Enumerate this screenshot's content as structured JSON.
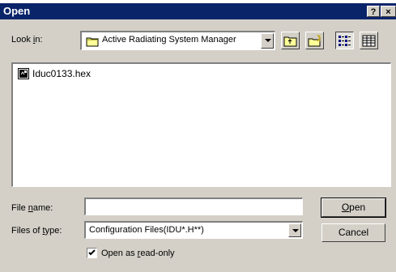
{
  "dialog": {
    "title": "Open"
  },
  "titlebar_buttons": {
    "help": "?",
    "close": "×"
  },
  "lookin": {
    "label_pre": "Look ",
    "label_u": "i",
    "label_post": "n:",
    "value": "Active Radiating System Manager"
  },
  "toolbar": {
    "icons": [
      "up-one-level-icon",
      "new-folder-icon",
      "list-view-icon",
      "details-view-icon"
    ]
  },
  "files": [
    {
      "name": "Iduc0133.hex",
      "icon": "hex-file-icon"
    }
  ],
  "filename": {
    "label_pre": "File ",
    "label_u": "n",
    "label_post": "ame:",
    "value": ""
  },
  "filetype": {
    "label_pre": "Files of ",
    "label_u": "t",
    "label_post": "ype:",
    "value": "Configuration Files(IDU*.H**)"
  },
  "buttons": {
    "open_u": "O",
    "open_rest": "pen",
    "cancel": "Cancel"
  },
  "readonly": {
    "checked": true,
    "label_pre": "Open as ",
    "label_u": "r",
    "label_post": "ead-only"
  },
  "colors": {
    "titlebar": "#0a246a",
    "face": "#d4d0c8"
  }
}
